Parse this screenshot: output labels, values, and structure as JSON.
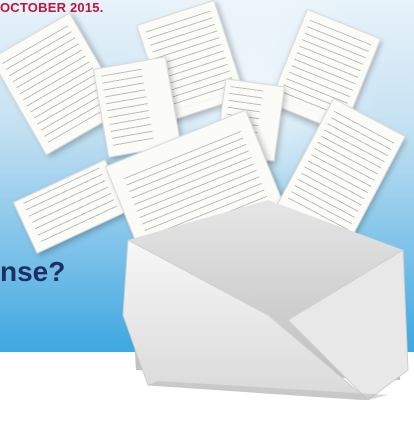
{
  "header": {
    "date_text": "OCTOBER 2015."
  },
  "headline": {
    "fragment": "nse?"
  },
  "colors": {
    "accent_red": "#c0143c",
    "headline_navy": "#1f2f63",
    "sky_blue": "#3ea7e0"
  },
  "illustration": {
    "subject": "flying-receipts-envelope"
  }
}
